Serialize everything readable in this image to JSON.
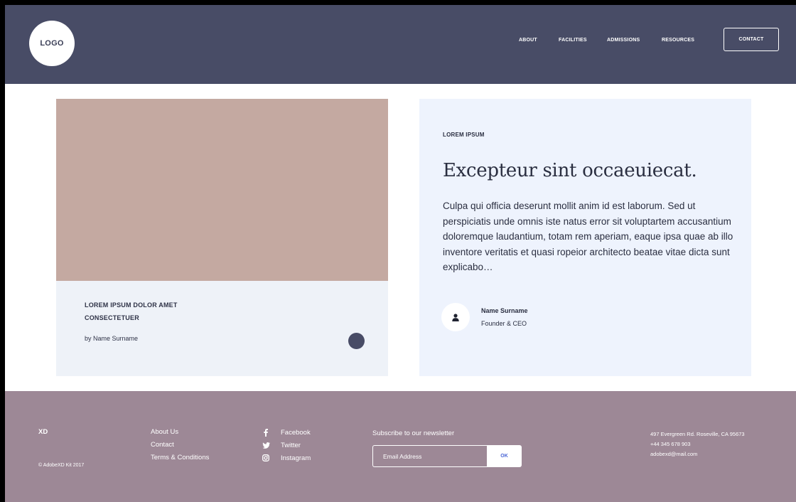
{
  "header": {
    "logo": "LOGO",
    "nav": [
      {
        "label": "ABOUT"
      },
      {
        "label": "FACILITIES"
      },
      {
        "label": "ADMISSIONS"
      },
      {
        "label": "RESOURCES"
      }
    ],
    "contact_button": "CONTACT"
  },
  "card_left": {
    "title": "LOREM IPSUM DOLOR AMET CONSECTETUER",
    "author": "by Name Surname"
  },
  "card_right": {
    "eyebrow": "LOREM IPSUM",
    "headline": "Excepteur sint occaeuiecat.",
    "body": "Culpa qui officia deserunt mollit anim id est laborum. Sed ut perspiciatis unde omnis iste natus error sit voluptartem accusantium doloremque laudantium, totam rem aperiam, eaque ipsa quae ab illo inventore veritatis et quasi ropeior architecto beatae vitae dicta sunt explicabo…",
    "person_name": "Name Surname",
    "person_role": "Founder & CEO"
  },
  "footer": {
    "brand": "XD",
    "copyright": "© AdobeXD Kit 2017",
    "links": [
      "About Us",
      "Contact",
      "Terms & Conditions"
    ],
    "social": [
      {
        "label": "Facebook",
        "icon": "facebook-icon"
      },
      {
        "label": "Twitter",
        "icon": "twitter-icon"
      },
      {
        "label": "Instagram",
        "icon": "instagram-icon"
      }
    ],
    "newsletter_title": "Subscribe to our newsletter",
    "email_placeholder": "Email Address",
    "ok_label": "OK",
    "address": "497 Evergreen Rd. Roseville, CA 95673",
    "phone": "+44 345 678 903",
    "email": "adobexd@mail.com"
  },
  "colors": {
    "header_bg": "#484c66",
    "footer_bg": "#9d8896",
    "image_placeholder": "#c4a9a1",
    "accent_blue": "#4a66d6"
  }
}
